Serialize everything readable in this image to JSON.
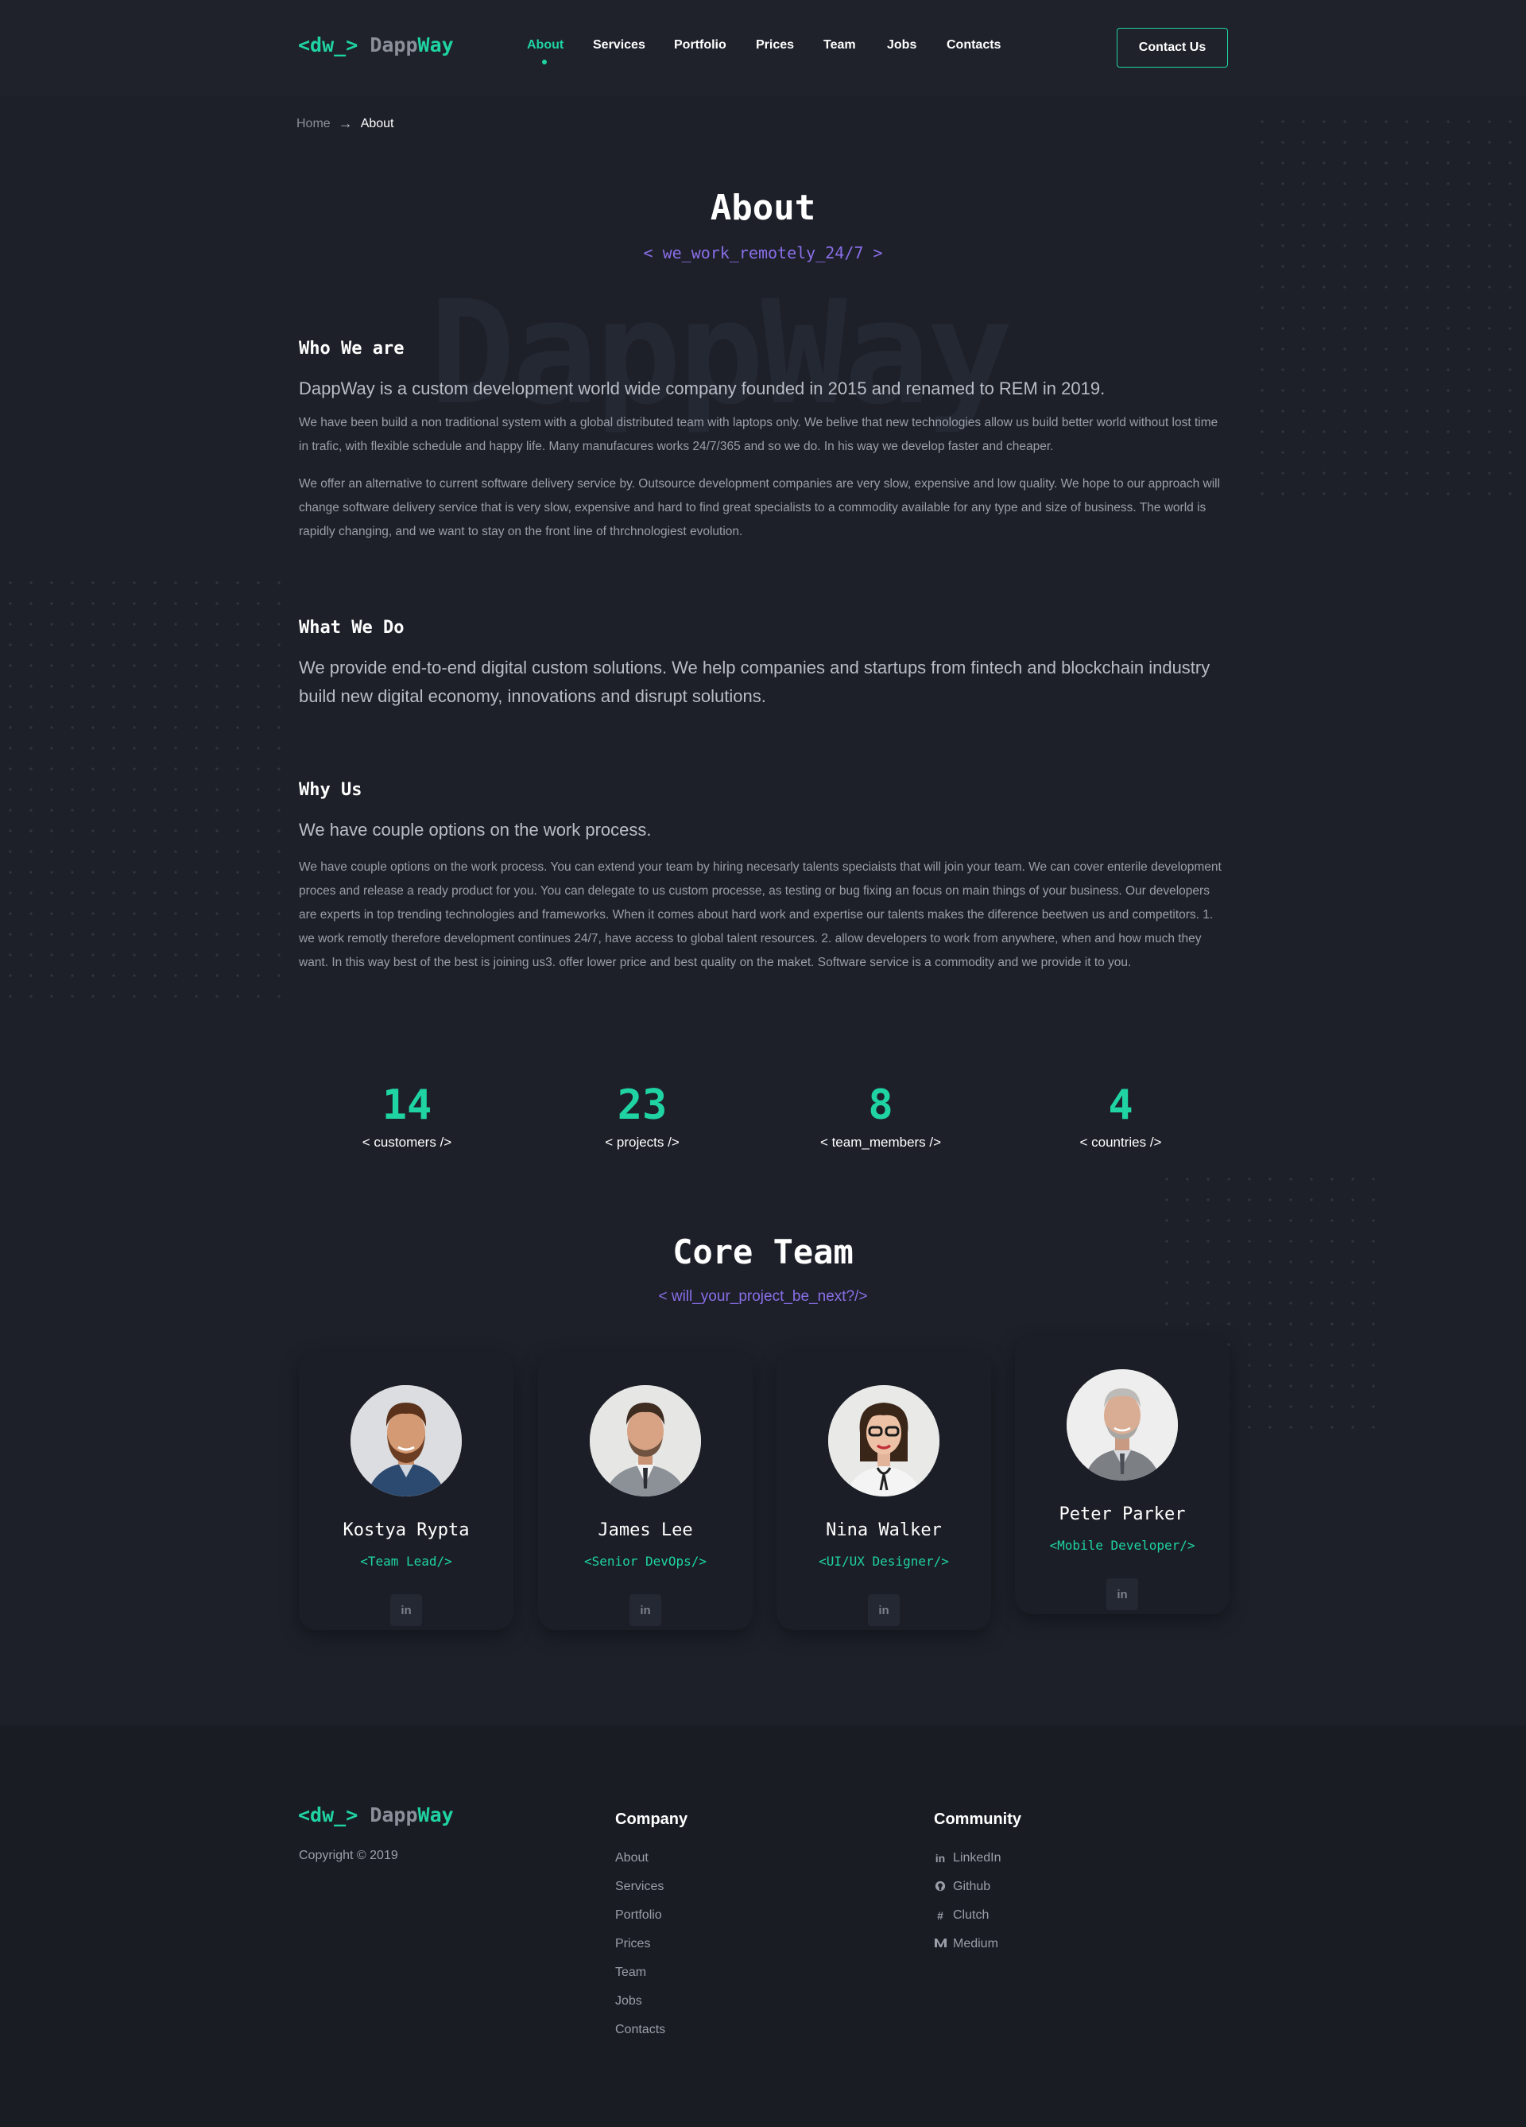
{
  "logo": {
    "bracket": "<dw_>",
    "dapp": "Dapp",
    "way": "Way"
  },
  "nav": {
    "items": [
      {
        "label": "About",
        "active": true
      },
      {
        "label": "Services"
      },
      {
        "label": "Portfolio"
      },
      {
        "label": "Prices"
      },
      {
        "label": "Team"
      },
      {
        "label": "Jobs"
      },
      {
        "label": "Contacts"
      }
    ],
    "cta": "Contact Us"
  },
  "breadcrumb": {
    "home": "Home",
    "current": "About"
  },
  "hero": {
    "title": "About",
    "subtitle": "< we_work_remotely_24/7 >",
    "watermark": "DappWay"
  },
  "sections": {
    "who": {
      "heading": "Who We are",
      "lead": "DappWay is a custom development world wide company founded in 2015 and renamed to REM in 2019.",
      "p1": "We have been build a non traditional system with a global distributed team with laptops only. We belive that new technologies allow us build better world without lost time in trafic, with flexible schedule and happy life. Many manufacures works 24/7/365 and so we do. In his way we develop faster and cheaper.",
      "p2": "We offer an alternative to current software delivery service by. Outsource development companies are very slow, expensive and low quality. We hope to our approach will change software delivery service that is very slow, expensive and hard to find great specialists to a commodity available for any type and size of business. The world is rapidly changing, and we want to stay on the front line of thrchnologiest evolution."
    },
    "what": {
      "heading": "What We Do",
      "lead": "We provide end-to-end digital custom solutions. We help companies and startups from fintech and blockchain industry build new digital economy, innovations and disrupt solutions."
    },
    "why": {
      "heading": "Why Us",
      "lead": "We have couple options on the work process.",
      "p1": "We have couple options on the work process. You can extend your team by hiring necesarly talents speciaists that will join your team. We can cover enterile development proces and release a ready product for you. You can delegate to us custom processe, as testing or bug fixing an focus on main things of your business. Our developers are experts in top trending technologies and frameworks. When it comes about hard work and expertise our talents makes the diference beetwen us and competitors. 1. we work remotly therefore development continues 24/7, have access to global talent resources. 2. allow developers to work from anywhere, when and how much they want. In this way best of the best is joining us3. offer lower price and best quality on the maket. Software service is a commodity and we provide it to you."
    }
  },
  "stats": [
    {
      "value": "14",
      "label": "< customers />"
    },
    {
      "value": "23",
      "label": "< projects />"
    },
    {
      "value": "8",
      "label": "< team_members />"
    },
    {
      "value": "4",
      "label": "< countries />"
    }
  ],
  "team": {
    "title": "Core Team",
    "subtitle": "< will_your_project_be_next?/>",
    "members": [
      {
        "name": "Kostya Rypta",
        "role": "<Team Lead/>",
        "social": "in"
      },
      {
        "name": "James Lee",
        "role": "<Senior DevOps/>",
        "social": "in"
      },
      {
        "name": "Nina Walker",
        "role": "<UI/UX Designer/>",
        "social": "in"
      },
      {
        "name": "Peter Parker",
        "role": "<Mobile Developer/>",
        "social": "in"
      }
    ]
  },
  "footer": {
    "copyright": "Copyright © 2019",
    "company": {
      "title": "Company",
      "links": [
        "About",
        "Services",
        "Portfolio",
        "Prices",
        "Team",
        "Jobs",
        "Contacts"
      ]
    },
    "community": {
      "title": "Community",
      "links": [
        {
          "label": "LinkedIn",
          "icon": "linkedin-icon"
        },
        {
          "label": "Github",
          "icon": "github-icon"
        },
        {
          "label": "Clutch",
          "icon": "clutch-icon"
        },
        {
          "label": "Medium",
          "icon": "medium-icon"
        }
      ]
    }
  },
  "colors": {
    "accent": "#1fd3a3",
    "purple": "#8a6ee8",
    "background": "#1d2029",
    "footer": "#1a1c23"
  }
}
